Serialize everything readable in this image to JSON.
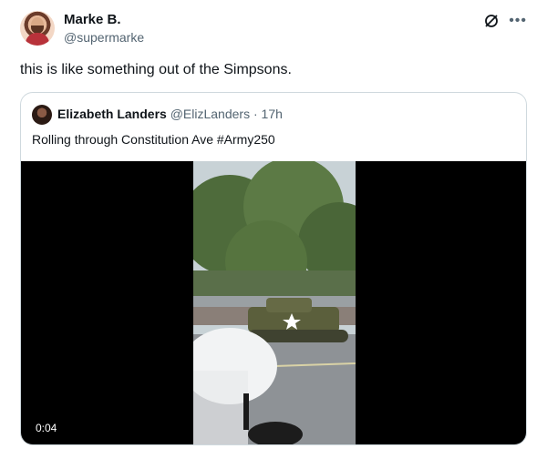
{
  "post": {
    "author_name": "Marke B.",
    "author_handle": "@supermarke",
    "text": "this is like something out of the Simpsons."
  },
  "quoted": {
    "author_name": "Elizabeth Landers",
    "author_handle": "@ElizLanders",
    "separator": "·",
    "time": "17h",
    "text": "Rolling through Constitution Ave #Army250",
    "video_time": "0:04"
  },
  "icons": {
    "grok": "grok-icon",
    "more": "more-icon"
  },
  "colors": {
    "text_primary": "#0f1419",
    "text_secondary": "#536471",
    "border": "#cfd9de",
    "video_bg": "#000000"
  }
}
